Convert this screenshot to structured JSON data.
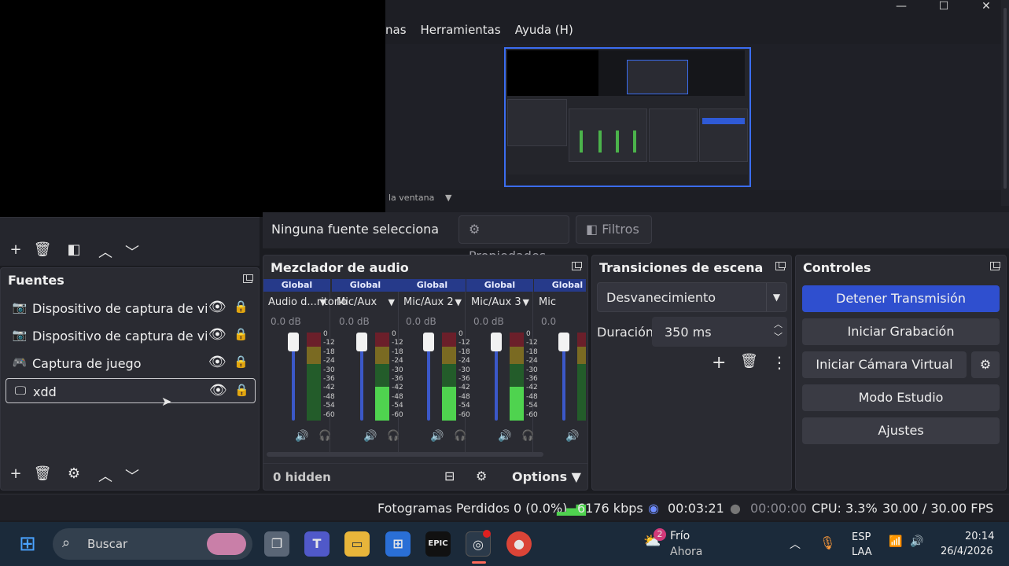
{
  "menu": {
    "items": [
      "nas",
      "Herramientas",
      "Ayuda (H)"
    ]
  },
  "window_controls": [
    "—",
    "☐",
    "✕"
  ],
  "preview": {
    "window_capture_label": "la ventana"
  },
  "properties_bar": {
    "no_source": "Ninguna fuente selecciona",
    "properties": "Propiedades",
    "filters": "Filtros"
  },
  "sources": {
    "title": "Fuentes",
    "items": [
      {
        "label": "Dispositivo de captura de video",
        "icon": "camera-icon"
      },
      {
        "label": "Dispositivo de captura de video",
        "icon": "camera-icon"
      },
      {
        "label": "Captura de juego",
        "icon": "gamepad-icon"
      },
      {
        "label": "xdd",
        "icon": "monitor-icon"
      }
    ]
  },
  "mixer": {
    "title": "Mezclador de audio",
    "channels": [
      {
        "tag": "Global",
        "name": "Audio d...ritorio",
        "db": "0.0 dB",
        "level": 0.0
      },
      {
        "tag": "Global",
        "name": "Mic/Aux",
        "db": "0.0 dB",
        "level": 0.38
      },
      {
        "tag": "Global",
        "name": "Mic/Aux 2",
        "db": "0.0 dB",
        "level": 0.38
      },
      {
        "tag": "Global",
        "name": "Mic/Aux 3",
        "db": "0.0 dB",
        "level": 0.38
      },
      {
        "tag": "Global",
        "name": "Mic",
        "db": "0.0",
        "level": 0.0
      }
    ],
    "scale": [
      "0",
      "-12",
      "-18",
      "-24",
      "-30",
      "-36",
      "-42",
      "-48",
      "-54",
      "-60"
    ],
    "hidden": "0 hidden",
    "options": "Options"
  },
  "transitions": {
    "title": "Transiciones de escena",
    "selected": "Desvanecimiento",
    "duration_label": "Duración",
    "duration_value": "350 ms"
  },
  "controls": {
    "title": "Controles",
    "stop_stream": "Detener Transmisión",
    "start_record": "Iniciar Grabación",
    "virtual_cam": "Iniciar Cámara Virtual",
    "studio_mode": "Modo Estudio",
    "settings": "Ajustes"
  },
  "status": {
    "dropped": "Fotogramas Perdidos 0 (0.0%)",
    "kbps": "6176 kbps",
    "stream_time": "00:03:21",
    "rec_time": "00:00:00",
    "cpu": "CPU: 3.3%",
    "fps": "30.00 / 30.00 FPS"
  },
  "taskbar": {
    "search": "Buscar",
    "weather_title": "Frío",
    "weather_sub": "Ahora",
    "weather_badge": "2",
    "lang_top": "ESP",
    "lang_bottom": "LAA",
    "time": "20:14",
    "date": "26/4/2026"
  },
  "colors": {
    "accent": "#2f4fcf",
    "meter_green": "#4fd34f",
    "global_tag": "#263a8a"
  }
}
